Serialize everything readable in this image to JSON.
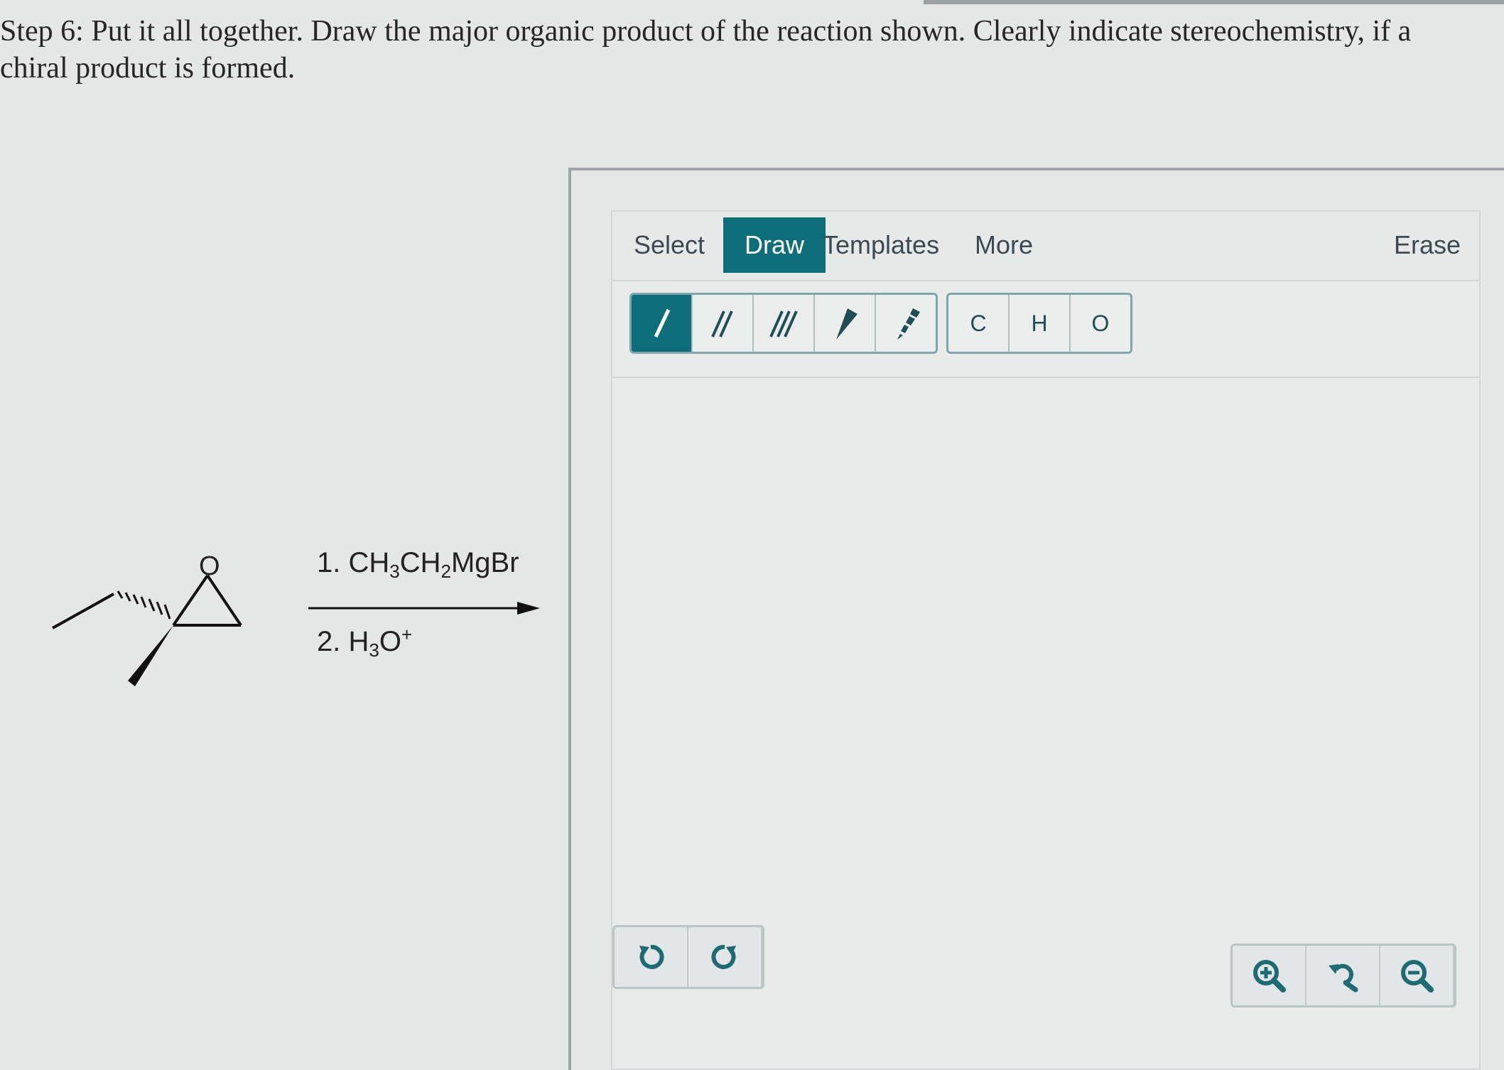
{
  "question": {
    "text": "Step 6: Put it all together. Draw the major organic product of the reaction shown. Clearly indicate stereochemistry, if a chiral product is formed."
  },
  "scheme": {
    "reagent1": {
      "prefix": "1. CH",
      "sub1": "3",
      "mid": "CH",
      "sub2": "2",
      "suffix": "MgBr"
    },
    "reagent2": {
      "prefix": "2. H",
      "sub1": "3",
      "mid": "O",
      "sup": "+"
    },
    "atom_label": "O"
  },
  "tabs": {
    "select": "Select",
    "draw": "Draw",
    "templates": "Templates",
    "more": "More",
    "erase": "Erase"
  },
  "tools": {
    "bonds": [
      "single-bond",
      "double-bond",
      "triple-bond",
      "wedge-bond",
      "hash-bond"
    ],
    "atoms": [
      "C",
      "H",
      "O"
    ]
  },
  "colors": {
    "accent": "#0d6e7a",
    "border": "#7fa6ad"
  }
}
